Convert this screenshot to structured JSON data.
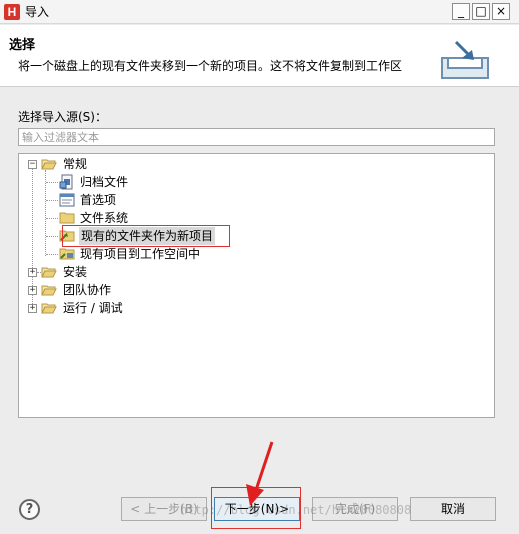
{
  "window": {
    "title": "导入",
    "app_icon_letter": "H",
    "minimize_glyph": "_",
    "maximize_glyph": "□",
    "close_glyph": "×"
  },
  "header": {
    "title": "选择",
    "description": "将一个磁盘上的现有文件夹移到一个新的项目。这不将文件复制到工作区"
  },
  "source": {
    "label": "选择导入源(S)：",
    "filter_placeholder": "输入过滤器文本",
    "filter_value": ""
  },
  "tree": {
    "groups": [
      {
        "label": "常规",
        "expanded": true,
        "expander": "−",
        "children": [
          {
            "label": "归档文件",
            "icon": "archive-icon"
          },
          {
            "label": "首选项",
            "icon": "preferences-icon"
          },
          {
            "label": "文件系统",
            "icon": "folder-icon"
          },
          {
            "label": "现有的文件夹作为新项目",
            "icon": "folder-import-icon",
            "selected": true
          },
          {
            "label": "现有项目到工作空间中",
            "icon": "project-import-icon"
          }
        ]
      },
      {
        "label": "安装",
        "expanded": false,
        "expander": "+"
      },
      {
        "label": "团队协作",
        "expanded": false,
        "expander": "+"
      },
      {
        "label": "运行 / 调试",
        "expanded": false,
        "expander": "+"
      }
    ]
  },
  "footer": {
    "help": "?",
    "back_label": "< 上一步(B)",
    "next_label": "下一步(N)>",
    "finish_label": "完成(F)",
    "cancel_label": "取消"
  },
  "watermark": "http://blog.csdn.net/hlx20080808",
  "colors": {
    "highlight_red": "#e03030",
    "selection": "#d9d9d9",
    "folder_yellow": "#e8c35a"
  }
}
